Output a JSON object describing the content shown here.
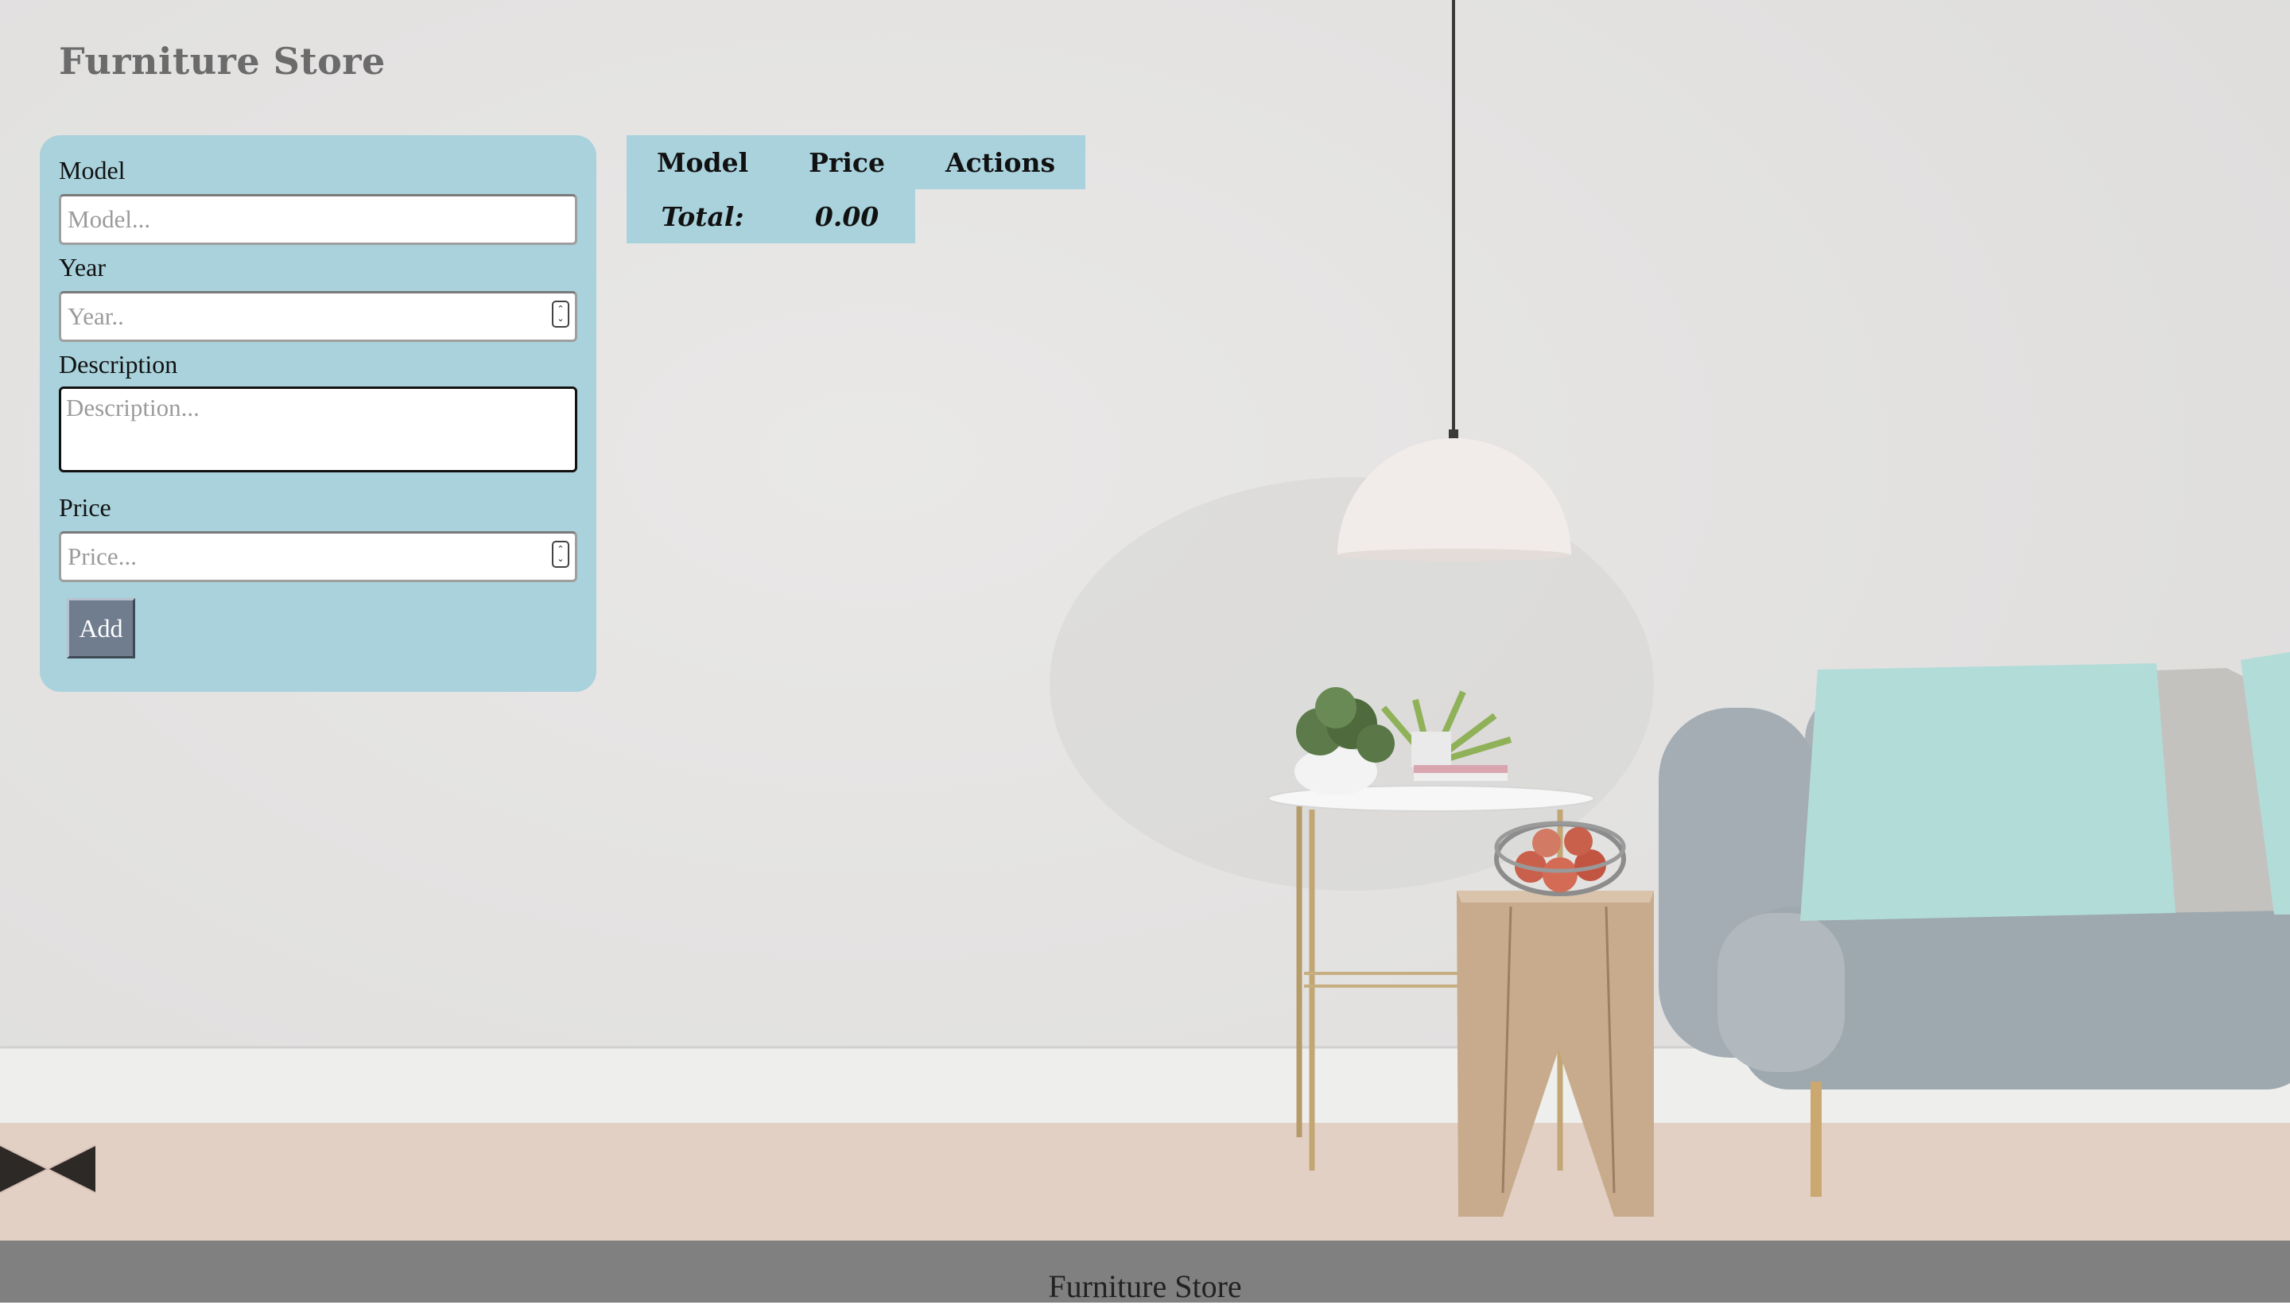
{
  "header": {
    "title": "Furniture Store"
  },
  "form": {
    "model": {
      "label": "Model",
      "placeholder": "Model...",
      "value": ""
    },
    "year": {
      "label": "Year",
      "placeholder": "Year..",
      "value": ""
    },
    "description": {
      "label": "Description",
      "placeholder": "Description...",
      "value": ""
    },
    "price": {
      "label": "Price",
      "placeholder": "Price...",
      "value": ""
    },
    "add_button_label": "Add"
  },
  "table": {
    "columns": [
      "Model",
      "Price",
      "Actions"
    ],
    "rows": [],
    "total_label": "Total:",
    "total_value": "0.00"
  },
  "footer": {
    "text": "Furniture Store"
  },
  "colors": {
    "panel": "#a9d2dc",
    "button": "#6f7d8f",
    "footer": "#808080",
    "title": "#6b6b6b"
  },
  "background": {
    "icons": [
      "pendant-lamp-icon",
      "side-table-icon",
      "potted-plant-icon",
      "wooden-stool-icon",
      "fruit-bowl-icon",
      "sofa-icon",
      "pillow-icon"
    ]
  }
}
